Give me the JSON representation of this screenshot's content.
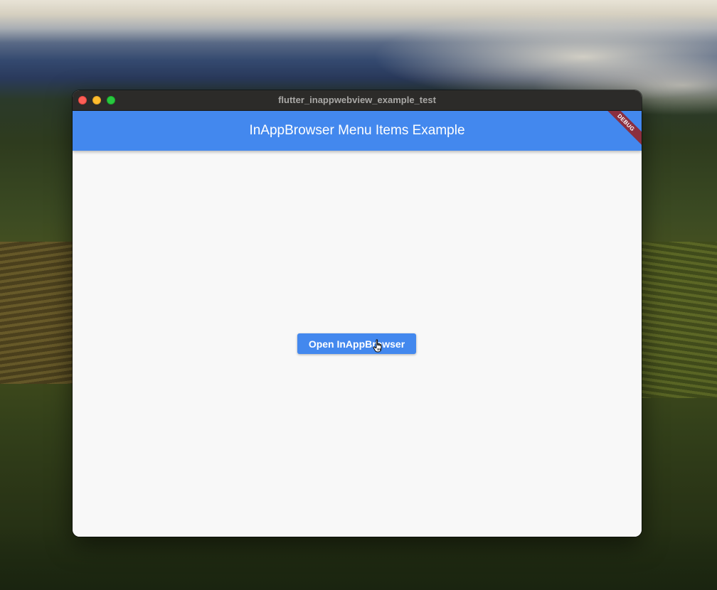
{
  "window": {
    "title": "flutter_inappwebview_example_test"
  },
  "appbar": {
    "title": "InAppBrowser Menu Items Example",
    "color": "#4388ee"
  },
  "debug_banner": {
    "label": "DEBUG",
    "color": "#8b2f3f"
  },
  "main": {
    "open_button_label": "Open InAppBrowser"
  },
  "icons": {
    "close": "close-traffic-light",
    "minimize": "minimize-traffic-light",
    "maximize": "maximize-traffic-light",
    "cursor": "hand-pointer-icon"
  }
}
